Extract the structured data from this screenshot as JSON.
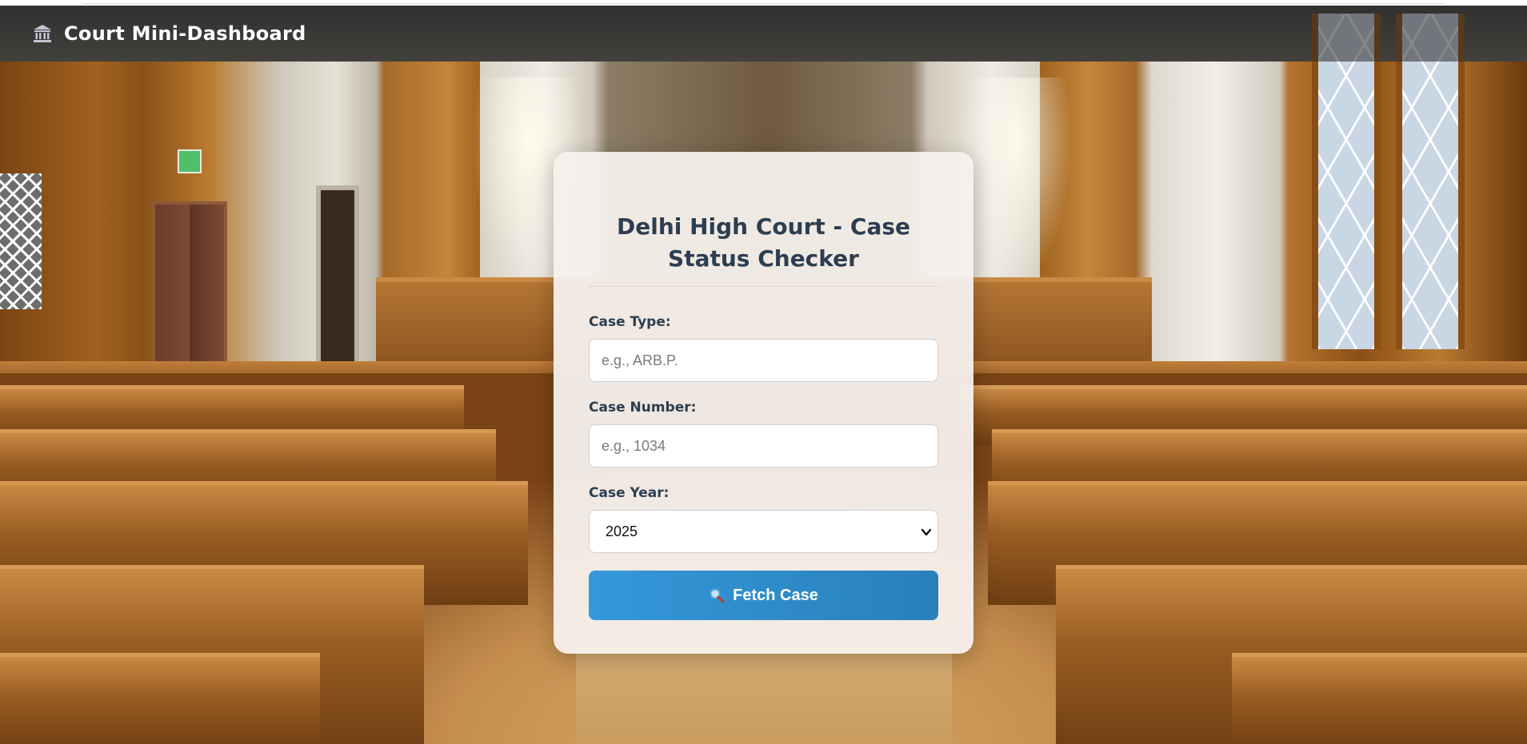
{
  "header": {
    "icon": "courthouse-icon",
    "title": "Court Mini-Dashboard"
  },
  "card": {
    "title": "Delhi High Court - Case Status Checker",
    "case_type": {
      "label": "Case Type:",
      "placeholder": "e.g., ARB.P.",
      "value": ""
    },
    "case_number": {
      "label": "Case Number:",
      "placeholder": "e.g., 1034",
      "value": ""
    },
    "case_year": {
      "label": "Case Year:",
      "selected": "2025"
    },
    "fetch_button": {
      "icon": "magnifier-icon",
      "label": "Fetch Case"
    }
  },
  "colors": {
    "title_text": "#2c3e50",
    "button_start": "#3498db",
    "button_end": "#2980b9",
    "header_bg": "rgba(40,40,40,0.55)"
  }
}
